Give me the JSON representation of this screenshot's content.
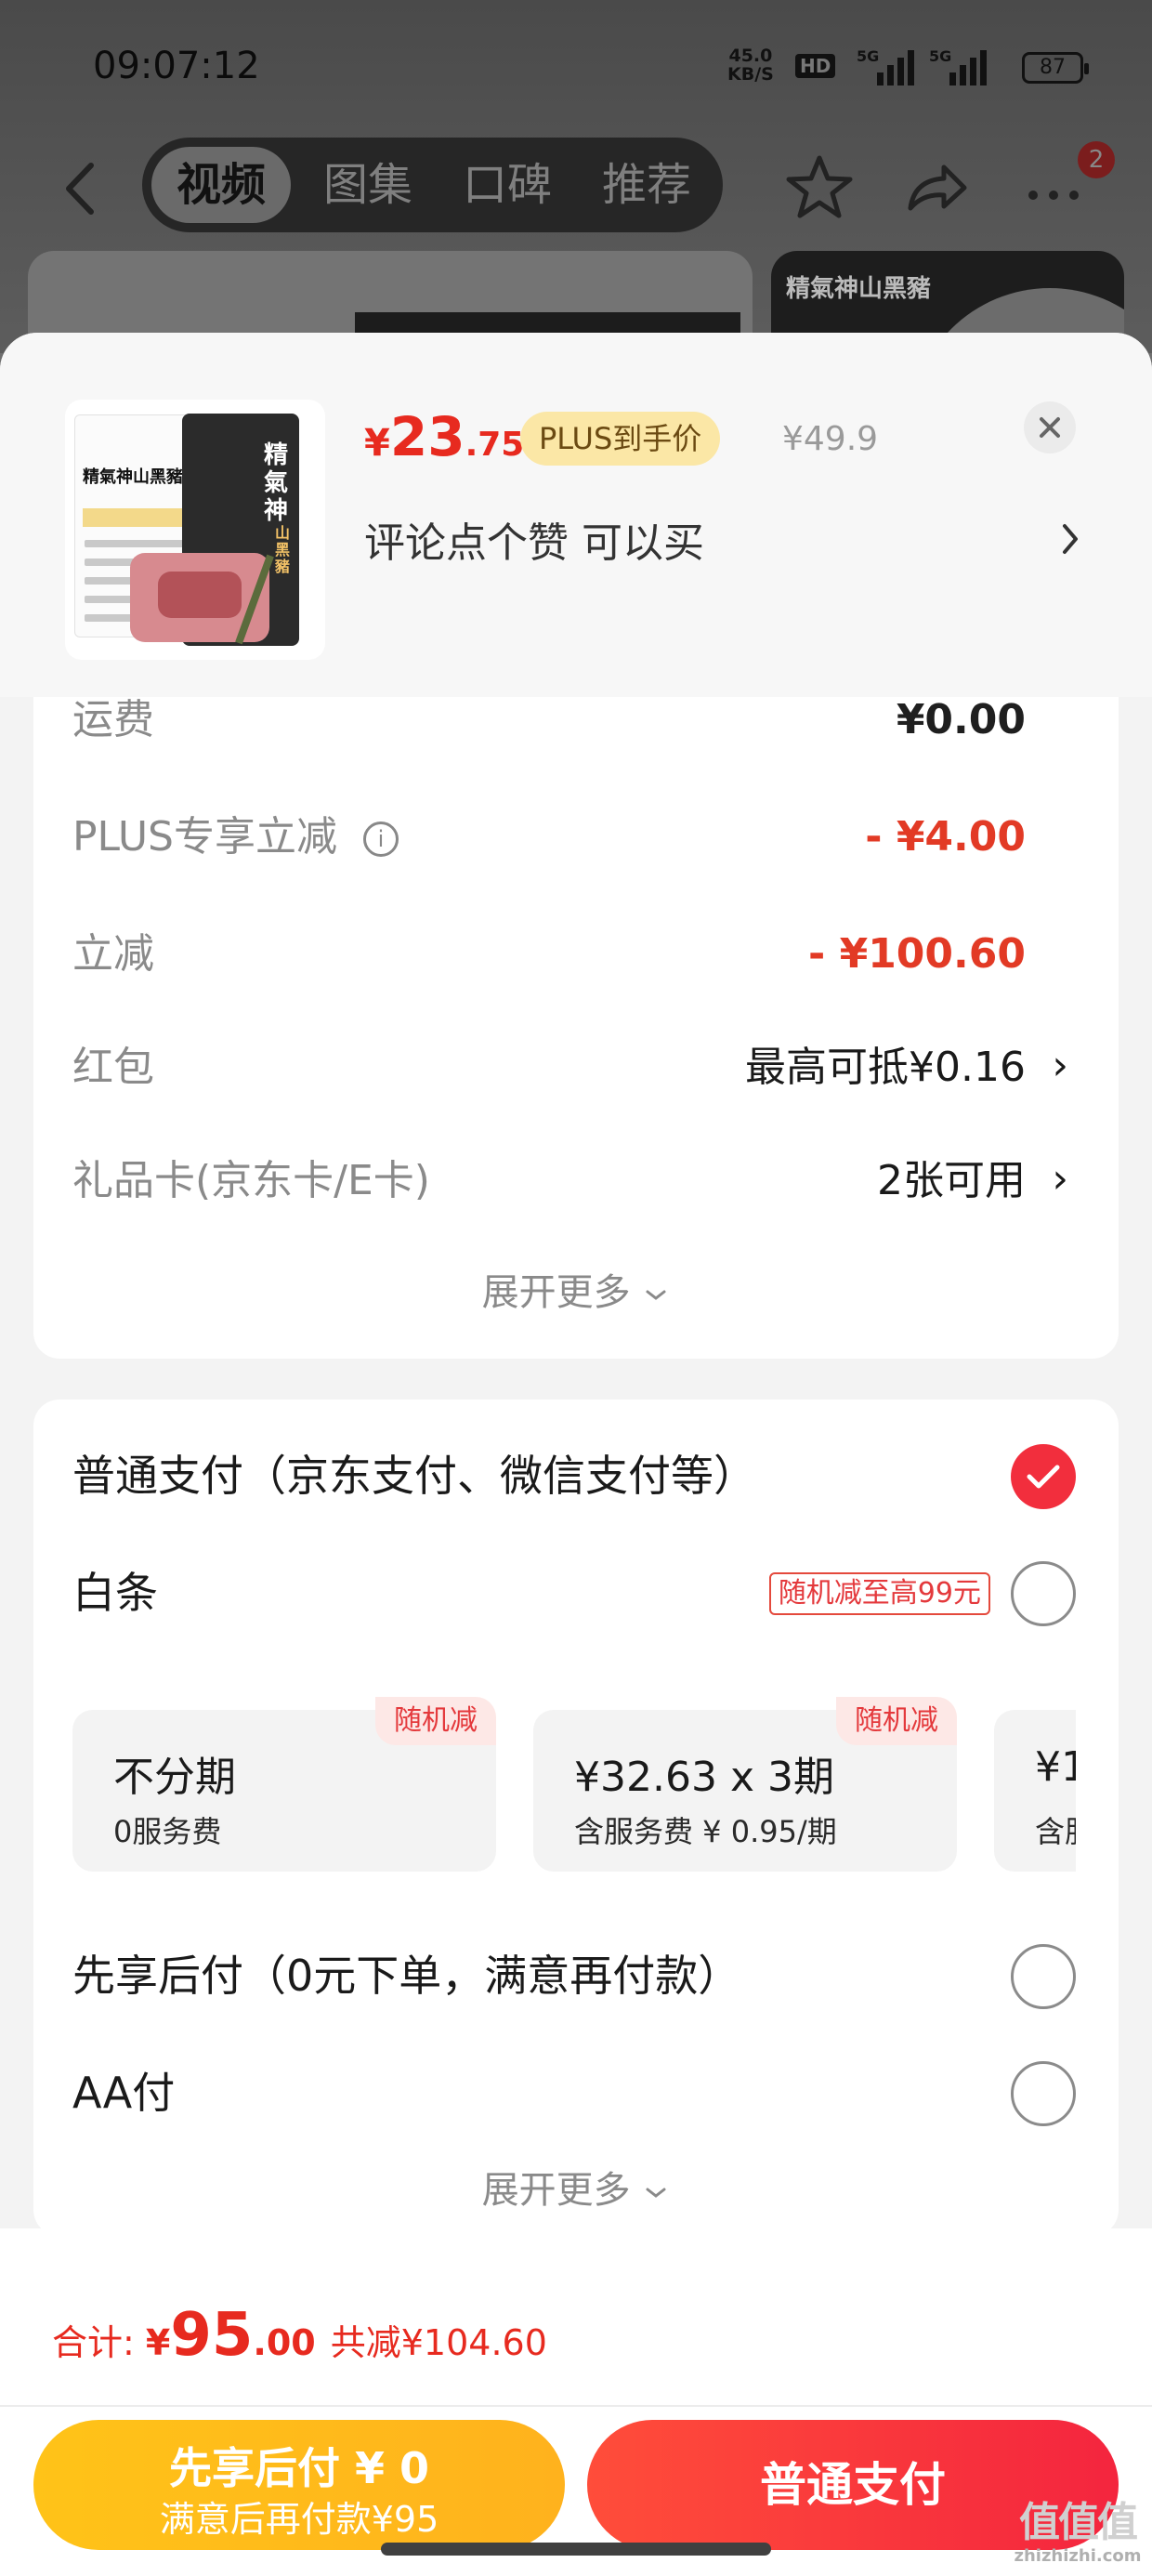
{
  "status_bar": {
    "time": "09:07:12",
    "net_speed_value": "45.0",
    "net_speed_unit": "KB/S",
    "hd_label": "HD",
    "sig1_label": "5G",
    "sig2_label": "5G",
    "battery": "87"
  },
  "nav": {
    "tabs": [
      {
        "label": "视频"
      },
      {
        "label": "图集"
      },
      {
        "label": "口碑"
      },
      {
        "label": "推荐"
      }
    ],
    "active_tab": "视频",
    "badge_count": "2"
  },
  "product": {
    "package_title": "精氣神",
    "package_sub": "山黑豬",
    "package_brand": "精氣神山黑豬",
    "bg_card_text": "精氣神山黑豬",
    "price_symbol": "¥",
    "price_int": "23",
    "price_dec": ".75",
    "plus_tag": "PLUS到手价",
    "original_price": "¥49.9",
    "comment": "评论点个赞  可以买"
  },
  "fees": {
    "rows": [
      {
        "label": "运费",
        "value": "¥0.00"
      },
      {
        "label": "PLUS专享立减",
        "value": "- ¥4.00"
      },
      {
        "label": "立减",
        "value": "- ¥100.60"
      },
      {
        "label": "红包",
        "value": "最高可抵¥0.16"
      },
      {
        "label": "礼品卡(京东卡/E卡)",
        "value": "2张可用"
      }
    ],
    "expand_label": "展开更多"
  },
  "payment": {
    "options": [
      {
        "label": "普通支付（京东支付、微信支付等）",
        "selected": true
      },
      {
        "label": "白条",
        "promo": "随机减至高99元",
        "selected": false
      },
      {
        "label": "先享后付（0元下单，满意再付款）",
        "selected": false
      },
      {
        "label": "AA付",
        "selected": false
      }
    ],
    "installments": [
      {
        "tag": "随机减",
        "title": "不分期",
        "sub": "0服务费"
      },
      {
        "tag": "随机减",
        "title": "¥32.63 x 3期",
        "sub": "含服务费 ¥ 0.95/期"
      },
      {
        "tag": "",
        "title": "¥1",
        "sub": "含服"
      }
    ],
    "expand_label": "展开更多"
  },
  "footer": {
    "total_label": "合计: ",
    "total_symbol": "¥",
    "total_int": "95",
    "total_dec": ".00",
    "total_saving": "共减¥104.60",
    "later_btn_line1": "先享后付 ¥ 0",
    "later_btn_line2": "满意后再付款¥95",
    "pay_btn": "普通支付"
  },
  "watermark": {
    "main": "值值值",
    "sub": "zhizhizhi.com"
  },
  "colors": {
    "accent_red": "#e72a1f",
    "selected_radio": "#f22e3d",
    "later_button": "#ffc318",
    "pay_button": "#f4253e",
    "plus_tag_bg": "#fbe7a6"
  }
}
